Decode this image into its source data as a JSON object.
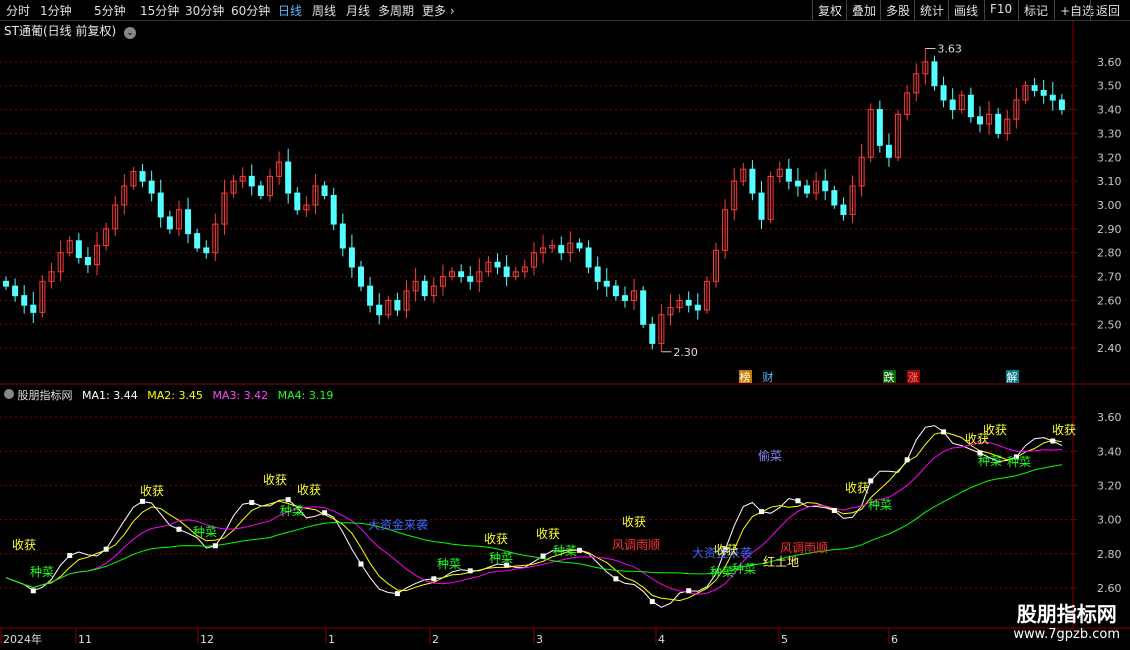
{
  "toolbar": {
    "periods": [
      "分时",
      "1分钟",
      "5分钟",
      "15分钟",
      "30分钟",
      "60分钟",
      "日线",
      "周线",
      "月线",
      "多周期",
      "更多"
    ],
    "active": "日线",
    "actions": [
      "复权",
      "叠加",
      "多股",
      "统计",
      "画线",
      "F10",
      "标记",
      "+自选",
      "返回"
    ]
  },
  "main_title": "ST通葡(日线 前复权)",
  "colors": {
    "up": "#ff3b3b",
    "down": "#54ffff",
    "ma1": "#ffffff",
    "ma2": "#ffff00",
    "ma3": "#ff00ff",
    "ma4": "#00ff00",
    "grid": "#7a0000",
    "axis_text": "#c8c8c8"
  },
  "chart_data": [
    {
      "type": "candlestick",
      "name": "price",
      "ylim": [
        2.3,
        3.7
      ],
      "yticks": [
        2.4,
        2.5,
        2.6,
        2.7,
        2.8,
        2.9,
        3.0,
        3.1,
        3.2,
        3.3,
        3.4,
        3.5,
        3.6
      ],
      "high_label": "3.63",
      "low_label": "2.30",
      "close": [
        2.66,
        2.62,
        2.58,
        2.55,
        2.68,
        2.72,
        2.8,
        2.85,
        2.78,
        2.75,
        2.83,
        2.9,
        3.0,
        3.08,
        3.14,
        3.1,
        3.05,
        2.95,
        2.9,
        2.98,
        2.88,
        2.82,
        2.8,
        2.92,
        3.05,
        3.1,
        3.12,
        3.08,
        3.04,
        3.12,
        3.18,
        3.05,
        2.98,
        3.0,
        3.08,
        3.04,
        2.92,
        2.82,
        2.74,
        2.66,
        2.58,
        2.54,
        2.6,
        2.56,
        2.64,
        2.68,
        2.62,
        2.66,
        2.7,
        2.72,
        2.7,
        2.68,
        2.72,
        2.76,
        2.74,
        2.7,
        2.72,
        2.74,
        2.8,
        2.82,
        2.83,
        2.8,
        2.84,
        2.82,
        2.74,
        2.68,
        2.66,
        2.62,
        2.6,
        2.64,
        2.5,
        2.42,
        2.54,
        2.57,
        2.6,
        2.58,
        2.56,
        2.68,
        2.81,
        2.98,
        3.1,
        3.15,
        3.05,
        2.94,
        3.12,
        3.15,
        3.1,
        3.08,
        3.05,
        3.1,
        3.06,
        3.0,
        2.96,
        3.08,
        3.2,
        3.4,
        3.25,
        3.2,
        3.38,
        3.47,
        3.55,
        3.6,
        3.5,
        3.44,
        3.4,
        3.46,
        3.37,
        3.34,
        3.38,
        3.3,
        3.36,
        3.44,
        3.5,
        3.48,
        3.46,
        3.44,
        3.4
      ],
      "markers": [
        "榜",
        "财",
        "跌",
        "涨",
        "解"
      ]
    },
    {
      "type": "line",
      "name": "indicator",
      "title": "股朋指标网",
      "ylim": [
        2.5,
        3.7
      ],
      "yticks": [
        2.6,
        2.8,
        3.0,
        3.2,
        3.4,
        3.6
      ],
      "series": [
        {
          "name": "MA1",
          "value": "3.44"
        },
        {
          "name": "MA2",
          "value": "3.45"
        },
        {
          "name": "MA3",
          "value": "3.42"
        },
        {
          "name": "MA4",
          "value": "3.19"
        }
      ],
      "signals": [
        "收获",
        "种菜",
        "收获",
        "种菜",
        "收获",
        "收获",
        "种菜",
        "大资金来袭",
        "种菜",
        "收获",
        "种菜",
        "收获",
        "种菜",
        "风调雨顺",
        "收获",
        "大资金来袭",
        "收获",
        "种菜",
        "种菜",
        "红土地",
        "风调雨顺",
        "偷菜",
        "收获",
        "种菜",
        "收获",
        "收获",
        "种菜",
        "种菜",
        "收获"
      ]
    }
  ],
  "xaxis": {
    "labels": [
      "2024年",
      "11",
      "12",
      "1",
      "2",
      "3",
      "4",
      "5",
      "6"
    ]
  },
  "watermark": {
    "name": "股朋指标网",
    "url": "www.7gpzb.com"
  }
}
